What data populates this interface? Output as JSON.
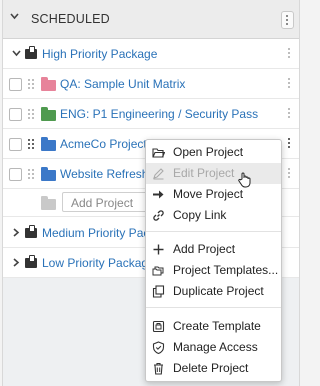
{
  "header": {
    "title": "SCHEDULED"
  },
  "packages": [
    {
      "name": "High Priority Package",
      "expanded": true
    },
    {
      "name": "Medium Priority Package",
      "expanded": false
    },
    {
      "name": "Low Priority Package",
      "expanded": false
    }
  ],
  "projects": [
    {
      "name": "QA: Sample Unit Matrix",
      "folder_color": "#e7839a"
    },
    {
      "name": "ENG: P1 Engineering / Security Pass",
      "folder_color": "#4f9a4f"
    },
    {
      "name": "AcmeCo Project Template",
      "folder_color": "#3b78c8"
    },
    {
      "name": "Website Refresh Project",
      "folder_color": "#3b78c8"
    }
  ],
  "add_project_input": {
    "placeholder": "Add Project"
  },
  "context_menu": {
    "items": [
      {
        "label": "Open Project",
        "icon": "folder-open-icon",
        "disabled": false
      },
      {
        "label": "Edit Project",
        "icon": "pencil-icon",
        "disabled": true
      },
      {
        "label": "Move Project",
        "icon": "arrow-right-icon",
        "disabled": false
      },
      {
        "label": "Copy Link",
        "icon": "link-icon",
        "disabled": false
      },
      {
        "label": "Add Project",
        "icon": "plus-icon",
        "disabled": false
      },
      {
        "label": "Project Templates...",
        "icon": "templates-icon",
        "disabled": false
      },
      {
        "label": "Duplicate Project",
        "icon": "duplicate-icon",
        "disabled": false
      },
      {
        "label": "Create Template",
        "icon": "create-template-icon",
        "disabled": false
      },
      {
        "label": "Manage Access",
        "icon": "shield-icon",
        "disabled": false
      },
      {
        "label": "Delete Project",
        "icon": "trash-icon",
        "disabled": false
      }
    ]
  },
  "colors": {
    "link": "#2a72b8",
    "menu_hover": "#eaeaea"
  }
}
